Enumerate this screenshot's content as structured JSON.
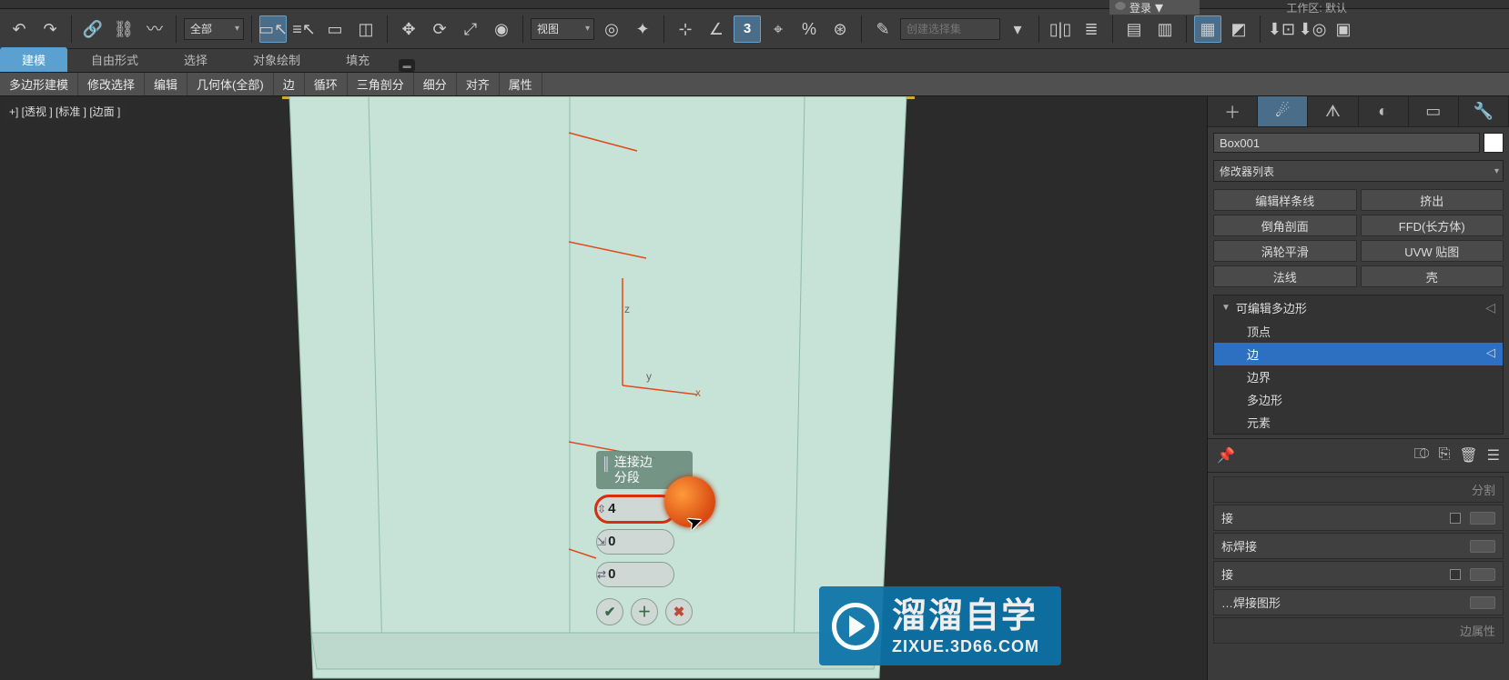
{
  "app": {
    "login_label": "登录",
    "workspace_label": "工作区: 默认"
  },
  "main_toolbar": {
    "filter_label": "全部",
    "ref_label": "视图",
    "named_set_placeholder": "创建选择集"
  },
  "ribbon": {
    "tabs": [
      "建模",
      "自由形式",
      "选择",
      "对象绘制",
      "填充"
    ],
    "subtabs": [
      "多边形建模",
      "修改选择",
      "编辑",
      "几何体(全部)",
      "边",
      "循环",
      "三角剖分",
      "细分",
      "对齐",
      "属性"
    ]
  },
  "viewport": {
    "label": "+] [透视 ] [标准 ] [边面 ]",
    "gizmo": {
      "x": "x",
      "y": "y",
      "z": "z"
    }
  },
  "caddy": {
    "title_line1": "连接边",
    "title_line2": "分段",
    "segments": "4",
    "pinch": "0",
    "slide": "0"
  },
  "command_panel": {
    "object_name": "Box001",
    "modifier_list_label": "修改器列表",
    "quick_buttons": [
      "编辑样条线",
      "挤出",
      "倒角剖面",
      "FFD(长方体)",
      "涡轮平滑",
      "UVW 贴图",
      "法线",
      "壳"
    ],
    "stack_head": "可编辑多边形",
    "stack_items": [
      "顶点",
      "边",
      "边界",
      "多边形",
      "元素"
    ],
    "stack_selected_index": 1,
    "rollouts": {
      "head_label": "分割",
      "rows": [
        "接",
        "标焊接",
        "接"
      ],
      "tail_label": "…焊接图形",
      "tail_caption": "边属性"
    }
  },
  "watermark": {
    "title": "溜溜自学",
    "url": "ZIXUE.3D66.COM"
  }
}
